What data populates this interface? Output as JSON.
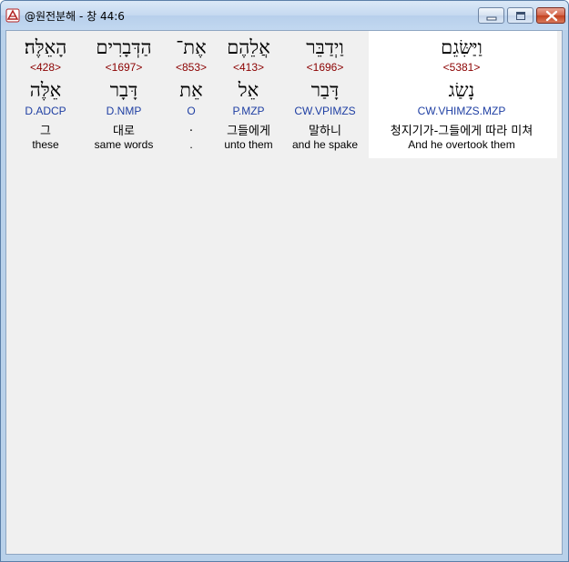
{
  "window": {
    "title": "@원전분해 - 창 44:6",
    "app_icon": "bible-app-icon",
    "controls": [
      "minimize",
      "maximize",
      "close"
    ]
  },
  "words": [
    {
      "hebrew": "וַיַּשִּׂגֵם",
      "strong": "<5381>",
      "root": "נָשַׂג",
      "morph": "CW.VHIMZS.MZP",
      "korean": "청지기가-그들에게 따라 미쳐",
      "english": "And he overtook them",
      "highlighted": true
    },
    {
      "hebrew": "וַיְדַבֵּר",
      "strong": "<1696>",
      "root": "דָּבַר",
      "morph": "CW.VPIMZS",
      "korean": "말하니",
      "english": "and he spake",
      "highlighted": false
    },
    {
      "hebrew": "אֲלֵהֶם",
      "strong": "<413>",
      "root": "אֵל",
      "morph": "P.MZP",
      "korean": "그들에게",
      "english": "unto them",
      "highlighted": false
    },
    {
      "hebrew": "אֶת־",
      "strong": "<853>",
      "root": "אֵת",
      "morph": "O",
      "korean": ".",
      "english": ".",
      "highlighted": false
    },
    {
      "hebrew": "הַדְּבָרִים",
      "strong": "<1697>",
      "root": "דָּבָר",
      "morph": "D.NMP",
      "korean": "대로",
      "english": "same words",
      "highlighted": false
    },
    {
      "hebrew": "הָאֵלֶּה׃",
      "strong": "<428>",
      "root": "אֵלֶּה",
      "morph": "D.ADCP",
      "korean": "그",
      "english": "these",
      "highlighted": false
    }
  ],
  "colors": {
    "strong_number": "#8b0000",
    "morphology": "#1f3fa3",
    "client_background": "#f0f0f0",
    "highlight_background": "#ffffff"
  }
}
